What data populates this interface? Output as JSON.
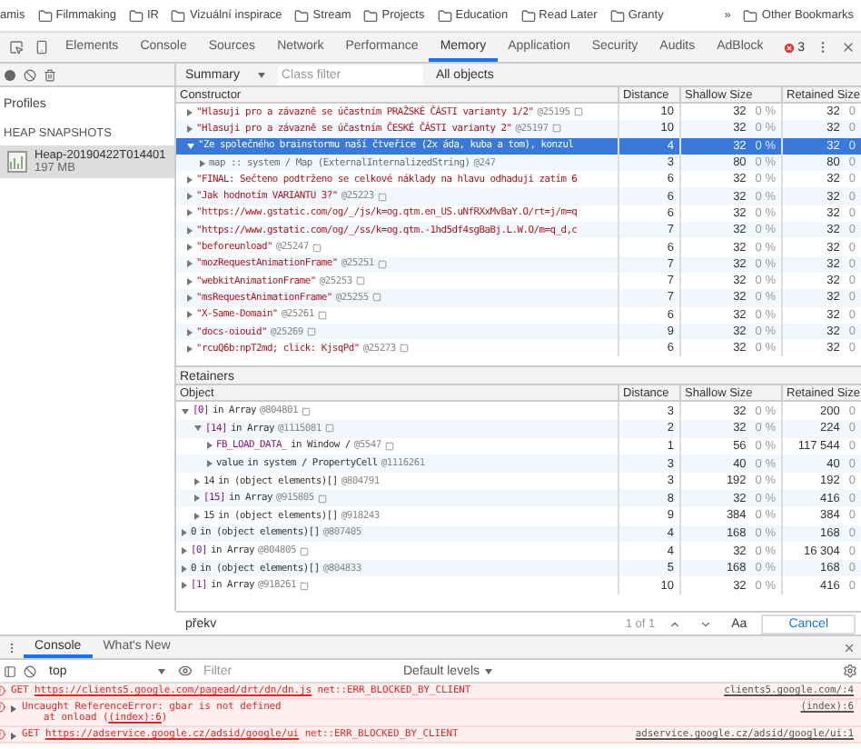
{
  "bookmarks": {
    "items": [
      {
        "label": "amis",
        "folder": false
      },
      {
        "label": "Filmmaking",
        "folder": true
      },
      {
        "label": "IR",
        "folder": true
      },
      {
        "label": "Vizuální inspirace",
        "folder": true
      },
      {
        "label": "Stream",
        "folder": true
      },
      {
        "label": "Projects",
        "folder": true
      },
      {
        "label": "Education",
        "folder": true
      },
      {
        "label": "Read Later",
        "folder": true
      },
      {
        "label": "Granty",
        "folder": true
      }
    ],
    "overflow": "»",
    "other": "Other Bookmarks"
  },
  "devtools_tabs": [
    {
      "label": "Elements",
      "selected": false
    },
    {
      "label": "Console",
      "selected": false
    },
    {
      "label": "Sources",
      "selected": false
    },
    {
      "label": "Network",
      "selected": false
    },
    {
      "label": "Performance",
      "selected": false
    },
    {
      "label": "Memory",
      "selected": true
    },
    {
      "label": "Application",
      "selected": false
    },
    {
      "label": "Security",
      "selected": false
    },
    {
      "label": "Audits",
      "selected": false
    },
    {
      "label": "AdBlock",
      "selected": false
    }
  ],
  "error_count": "3",
  "toolbar": {
    "view": "Summary",
    "class_filter_placeholder": "Class filter",
    "objects": "All objects"
  },
  "sidebar": {
    "title": "Profiles",
    "section": "HEAP SNAPSHOTS",
    "snapshots": [
      {
        "name": "Heap-20190422T014401",
        "size": "197 MB",
        "selected": true
      }
    ]
  },
  "constructor_table": {
    "columns": [
      "Constructor",
      "Distance",
      "Shallow Size",
      "Retained Size"
    ],
    "rows": [
      {
        "kind": "string",
        "name": "\"Hlasuji pro a závazně se účastním PRAŽSKÉ ČÁSTI varianty 1/2\"",
        "id": "@25195",
        "store_icon": true,
        "distance": "10",
        "shallow": "32",
        "shallow_pct": "0 %",
        "retained": "32",
        "retained_pct": "0",
        "expanded": false,
        "selected": false
      },
      {
        "kind": "string",
        "name": "\"Hlasuji pro a závazně se účastním ČESKÉ ČÁSTI varianty 2\"",
        "id": "@25197",
        "store_icon": true,
        "distance": "10",
        "shallow": "32",
        "shallow_pct": "0 %",
        "retained": "32",
        "retained_pct": "0",
        "expanded": false,
        "selected": false
      },
      {
        "kind": "string",
        "name": "\"Ze společného brainstormu naší čtveřice (2x áda, kuba a tom), konzul",
        "id": "",
        "store_icon": false,
        "distance": "4",
        "shallow": "32",
        "shallow_pct": "0 %",
        "retained": "32",
        "retained_pct": "0",
        "expanded": true,
        "selected": true,
        "children": [
          {
            "kind": "system",
            "name": "map :: system / Map (ExternalInternalizedString)",
            "id": "@247",
            "store_icon": false,
            "distance": "3",
            "shallow": "80",
            "shallow_pct": "0 %",
            "retained": "80",
            "retained_pct": "0",
            "expanded": false,
            "selected": false
          }
        ]
      },
      {
        "kind": "string",
        "name": "\"FINAL: Sečteno podtrženo se celkové náklady na hlavu odhaduji zatím 6",
        "id": "",
        "store_icon": false,
        "distance": "6",
        "shallow": "32",
        "shallow_pct": "0 %",
        "retained": "32",
        "retained_pct": "0",
        "expanded": false,
        "selected": false
      },
      {
        "kind": "string",
        "name": "\"Jak hodnotím VARIANTU 3?\"",
        "id": "@25223",
        "store_icon": true,
        "distance": "6",
        "shallow": "32",
        "shallow_pct": "0 %",
        "retained": "32",
        "retained_pct": "0",
        "expanded": false,
        "selected": false
      },
      {
        "kind": "string",
        "name": "\"https://www.gstatic.com/og/_/js/k=og.qtm.en_US.uNfRXxMvBaY.O/rt=j/m=q",
        "id": "",
        "store_icon": false,
        "distance": "6",
        "shallow": "32",
        "shallow_pct": "0 %",
        "retained": "32",
        "retained_pct": "0",
        "expanded": false,
        "selected": false
      },
      {
        "kind": "string",
        "name": "\"https://www.gstatic.com/og/_/ss/k=og.qtm.-1hd5df4sgBaBj.L.W.O/m=q_d,c",
        "id": "",
        "store_icon": false,
        "distance": "7",
        "shallow": "32",
        "shallow_pct": "0 %",
        "retained": "32",
        "retained_pct": "0",
        "expanded": false,
        "selected": false
      },
      {
        "kind": "string",
        "name": "\"beforeunload\"",
        "id": "@25247",
        "store_icon": true,
        "distance": "6",
        "shallow": "32",
        "shallow_pct": "0 %",
        "retained": "32",
        "retained_pct": "0",
        "expanded": false,
        "selected": false
      },
      {
        "kind": "string",
        "name": "\"mozRequestAnimationFrame\"",
        "id": "@25251",
        "store_icon": true,
        "distance": "7",
        "shallow": "32",
        "shallow_pct": "0 %",
        "retained": "32",
        "retained_pct": "0",
        "expanded": false,
        "selected": false
      },
      {
        "kind": "string",
        "name": "\"webkitAnimationFrame\"",
        "id": "@25253",
        "store_icon": true,
        "distance": "7",
        "shallow": "32",
        "shallow_pct": "0 %",
        "retained": "32",
        "retained_pct": "0",
        "expanded": false,
        "selected": false
      },
      {
        "kind": "string",
        "name": "\"msRequestAnimationFrame\"",
        "id": "@25255",
        "store_icon": true,
        "distance": "7",
        "shallow": "32",
        "shallow_pct": "0 %",
        "retained": "32",
        "retained_pct": "0",
        "expanded": false,
        "selected": false
      },
      {
        "kind": "string",
        "name": "\"X-Same-Domain\"",
        "id": "@25261",
        "store_icon": true,
        "distance": "6",
        "shallow": "32",
        "shallow_pct": "0 %",
        "retained": "32",
        "retained_pct": "0",
        "expanded": false,
        "selected": false
      },
      {
        "kind": "string",
        "name": "\"docs-oiouid\"",
        "id": "@25269",
        "store_icon": true,
        "distance": "9",
        "shallow": "32",
        "shallow_pct": "0 %",
        "retained": "32",
        "retained_pct": "0",
        "expanded": false,
        "selected": false
      },
      {
        "kind": "string",
        "name": "\"rcuQ6b:npT2md; click: KjsqPd\"",
        "id": "@25273",
        "store_icon": true,
        "distance": "6",
        "shallow": "32",
        "shallow_pct": "0 %",
        "retained": "32",
        "retained_pct": "0",
        "expanded": false,
        "selected": false
      }
    ]
  },
  "retainers": {
    "title": "Retainers",
    "columns": [
      "Object",
      "Distance",
      "Shallow Size",
      "Retained Size"
    ],
    "rows": [
      {
        "kind": "property",
        "edge": "[0]",
        "rest": "in Array",
        "id": "@804801",
        "store_icon": true,
        "distance": "3",
        "shallow": "32",
        "shallow_pct": "0 %",
        "retained": "200",
        "retained_pct": "0",
        "expanded": true,
        "children": [
          {
            "kind": "property",
            "edge": "[14]",
            "rest": "in Array",
            "id": "@1115081",
            "store_icon": true,
            "distance": "2",
            "shallow": "32",
            "shallow_pct": "0 %",
            "retained": "224",
            "retained_pct": "0",
            "expanded": true,
            "children": [
              {
                "kind": "property",
                "edge": "FB_LOAD_DATA_",
                "rest": "in Window /",
                "id": "@5547",
                "store_icon": true,
                "distance": "1",
                "shallow": "56",
                "shallow_pct": "0 %",
                "retained": "117 544",
                "retained_pct": "0",
                "expanded": false
              },
              {
                "kind": "internal",
                "edge": "value",
                "rest": "in system / PropertyCell",
                "id": "@1116261",
                "store_icon": false,
                "distance": "3",
                "shallow": "40",
                "shallow_pct": "0 %",
                "retained": "40",
                "retained_pct": "0",
                "expanded": false
              }
            ]
          },
          {
            "kind": "internal",
            "edge": "14",
            "rest": "in (object elements)[]",
            "id": "@804791",
            "store_icon": false,
            "distance": "3",
            "shallow": "192",
            "shallow_pct": "0 %",
            "retained": "192",
            "retained_pct": "0",
            "expanded": false
          },
          {
            "kind": "property",
            "edge": "[15]",
            "rest": "in Array",
            "id": "@915805",
            "store_icon": true,
            "distance": "8",
            "shallow": "32",
            "shallow_pct": "0 %",
            "retained": "416",
            "retained_pct": "0",
            "expanded": false
          },
          {
            "kind": "internal",
            "edge": "15",
            "rest": "in (object elements)[]",
            "id": "@918243",
            "store_icon": false,
            "distance": "9",
            "shallow": "384",
            "shallow_pct": "0 %",
            "retained": "384",
            "retained_pct": "0",
            "expanded": false
          }
        ]
      },
      {
        "kind": "internal",
        "edge": "0",
        "rest": "in (object elements)[]",
        "id": "@807405",
        "store_icon": false,
        "distance": "4",
        "shallow": "168",
        "shallow_pct": "0 %",
        "retained": "168",
        "retained_pct": "0",
        "expanded": false
      },
      {
        "kind": "property",
        "edge": "[0]",
        "rest": "in Array",
        "id": "@804805",
        "store_icon": true,
        "distance": "4",
        "shallow": "32",
        "shallow_pct": "0 %",
        "retained": "16 304",
        "retained_pct": "0",
        "expanded": false
      },
      {
        "kind": "internal",
        "edge": "0",
        "rest": "in (object elements)[]",
        "id": "@804833",
        "store_icon": false,
        "distance": "5",
        "shallow": "168",
        "shallow_pct": "0 %",
        "retained": "168",
        "retained_pct": "0",
        "expanded": false
      },
      {
        "kind": "property",
        "edge": "[1]",
        "rest": "in Array",
        "id": "@918261",
        "store_icon": true,
        "distance": "10",
        "shallow": "32",
        "shallow_pct": "0 %",
        "retained": "416",
        "retained_pct": "0",
        "expanded": false
      }
    ]
  },
  "search": {
    "value": "překv",
    "matches": "1 of 1",
    "case_toggle": "Aa",
    "cancel": "Cancel"
  },
  "drawer": {
    "tabs": [
      {
        "label": "Console",
        "selected": true
      },
      {
        "label": "What's New",
        "selected": false
      }
    ],
    "context": "top",
    "filter_placeholder": "Filter",
    "levels": "Default levels",
    "messages": [
      {
        "kind": "network",
        "expandable": false,
        "method": "GET",
        "url": "https://clients5.google.com/pagead/drt/dn/dn.js",
        "error": "net::ERR_BLOCKED_BY_CLIENT",
        "source": "clients5.google.com/:4"
      },
      {
        "kind": "exception",
        "expandable": true,
        "text": "Uncaught ReferenceError: gbar is not defined",
        "detail": "at onload (",
        "detail_link": "(index):6",
        "detail_end": ")",
        "source": "(index):6"
      },
      {
        "kind": "network",
        "expandable": true,
        "method": "GET",
        "url": "https://adservice.google.cz/adsid/google/ui",
        "error": "net::ERR_BLOCKED_BY_CLIENT",
        "source": "adservice.google.cz/adsid/google/ui:1"
      }
    ]
  }
}
